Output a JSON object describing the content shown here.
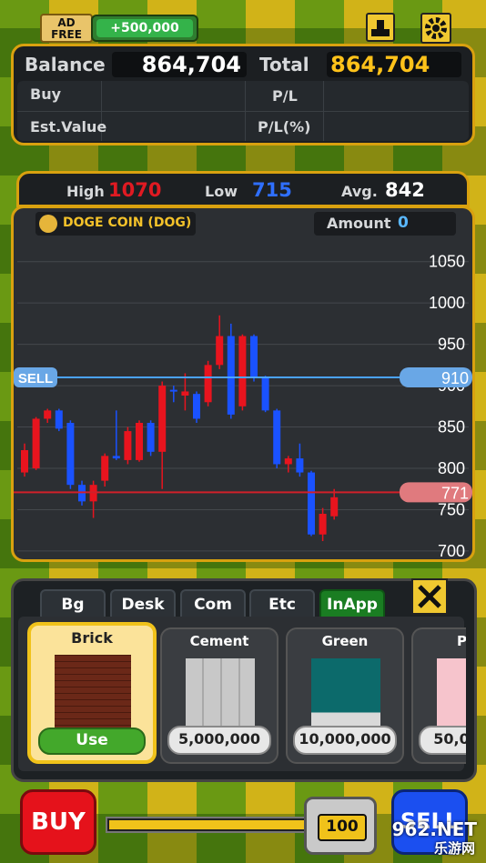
{
  "ad_free": {
    "line1": "AD",
    "line2": "FREE"
  },
  "reward_button": {
    "label": "+500,000"
  },
  "account": {
    "balance_label": "Balance",
    "balance_value": "864,704",
    "total_label": "Total",
    "total_value": "864,704",
    "buy_label": "Buy",
    "buy_value": "",
    "pl_label": "P/L",
    "pl_value": "",
    "est_label": "Est.Value",
    "est_value": "",
    "plpct_label": "P/L(%)",
    "plpct_value": ""
  },
  "stats": {
    "high_label": "High",
    "high_value": "1070",
    "low_label": "Low",
    "low_value": "715",
    "avg_label": "Avg.",
    "avg_value": "842"
  },
  "coin": {
    "name": "DOGE COIN (DOG)",
    "amount_label": "Amount",
    "amount_value": "0"
  },
  "chart_data": {
    "type": "candlestick",
    "y_ticks": [
      "1050",
      "1000",
      "950",
      "900",
      "850",
      "800",
      "750",
      "700"
    ],
    "ylim": [
      690,
      1075
    ],
    "sell_line": {
      "label": "SELL",
      "value": "910"
    },
    "buy_line": {
      "value": "771"
    },
    "colors": {
      "up": "#e8141e",
      "down": "#1a52ff"
    },
    "candles": [
      {
        "o": 795,
        "c": 822,
        "h": 830,
        "l": 790
      },
      {
        "o": 800,
        "c": 860,
        "h": 862,
        "l": 798
      },
      {
        "o": 860,
        "c": 870,
        "h": 872,
        "l": 855
      },
      {
        "o": 870,
        "c": 848,
        "h": 872,
        "l": 845
      },
      {
        "o": 855,
        "c": 780,
        "h": 858,
        "l": 775
      },
      {
        "o": 780,
        "c": 760,
        "h": 785,
        "l": 755
      },
      {
        "o": 760,
        "c": 780,
        "h": 785,
        "l": 740
      },
      {
        "o": 785,
        "c": 815,
        "h": 818,
        "l": 778
      },
      {
        "o": 815,
        "c": 812,
        "h": 870,
        "l": 810
      },
      {
        "o": 810,
        "c": 845,
        "h": 850,
        "l": 805
      },
      {
        "o": 810,
        "c": 855,
        "h": 858,
        "l": 808
      },
      {
        "o": 855,
        "c": 820,
        "h": 858,
        "l": 815
      },
      {
        "o": 820,
        "c": 900,
        "h": 905,
        "l": 775
      },
      {
        "o": 895,
        "c": 893,
        "h": 900,
        "l": 880
      },
      {
        "o": 888,
        "c": 893,
        "h": 915,
        "l": 870
      },
      {
        "o": 890,
        "c": 860,
        "h": 893,
        "l": 855
      },
      {
        "o": 880,
        "c": 925,
        "h": 930,
        "l": 875
      },
      {
        "o": 925,
        "c": 960,
        "h": 985,
        "l": 920
      },
      {
        "o": 960,
        "c": 865,
        "h": 975,
        "l": 860
      },
      {
        "o": 875,
        "c": 960,
        "h": 962,
        "l": 870
      },
      {
        "o": 960,
        "c": 910,
        "h": 962,
        "l": 905
      },
      {
        "o": 910,
        "c": 870,
        "h": 912,
        "l": 868
      },
      {
        "o": 870,
        "c": 805,
        "h": 872,
        "l": 800
      },
      {
        "o": 805,
        "c": 812,
        "h": 815,
        "l": 795
      },
      {
        "o": 812,
        "c": 795,
        "h": 830,
        "l": 790
      },
      {
        "o": 795,
        "c": 720,
        "h": 797,
        "l": 718
      },
      {
        "o": 720,
        "c": 745,
        "h": 752,
        "l": 712
      },
      {
        "o": 742,
        "c": 765,
        "h": 775,
        "l": 738
      }
    ]
  },
  "shop": {
    "tabs": [
      "Bg",
      "Desk",
      "Com",
      "Etc",
      "InApp"
    ],
    "active_tab": "InApp",
    "items": [
      {
        "name": "Brick",
        "action": "Use"
      },
      {
        "name": "Cement",
        "action": "5,000,000"
      },
      {
        "name": "Green",
        "action": "10,000,000"
      },
      {
        "name": "P",
        "action": "50,0"
      }
    ]
  },
  "controls": {
    "buy_label": "BUY",
    "sell_label": "SELL",
    "quantity": "100"
  },
  "watermark": {
    "brand": "962.NET",
    "sub": "乐游网"
  }
}
